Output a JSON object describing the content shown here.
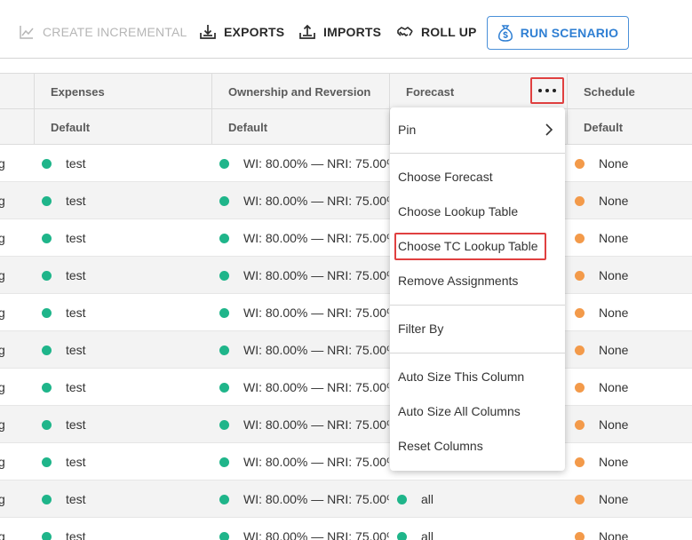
{
  "toolbar": {
    "create_incremental": "CREATE INCREMENTAL",
    "exports": "EXPORTS",
    "imports": "IMPORTS",
    "roll_up": "ROLL UP",
    "run_scenario": "RUN SCENARIO",
    "accent_color": "#2f7fd3"
  },
  "columns": [
    {
      "key": "col0",
      "label": "",
      "sub": ""
    },
    {
      "key": "expenses",
      "label": "Expenses",
      "sub": "Default"
    },
    {
      "key": "ownership",
      "label": "Ownership and Reversion",
      "sub": "Default"
    },
    {
      "key": "forecast",
      "label": "Forecast",
      "sub": ""
    },
    {
      "key": "schedule",
      "label": "Schedule",
      "sub": "Default"
    }
  ],
  "rows": [
    {
      "c0": "g",
      "expenses": "test",
      "ownership": "WI: 80.00% — NRI: 75.00%",
      "forecast": "",
      "schedule": "None"
    },
    {
      "c0": "g",
      "expenses": "test",
      "ownership": "WI: 80.00% — NRI: 75.00%",
      "forecast": "",
      "schedule": "None"
    },
    {
      "c0": "g",
      "expenses": "test",
      "ownership": "WI: 80.00% — NRI: 75.00%",
      "forecast": "",
      "schedule": "None"
    },
    {
      "c0": "g",
      "expenses": "test",
      "ownership": "WI: 80.00% — NRI: 75.00%",
      "forecast": "",
      "schedule": "None"
    },
    {
      "c0": "g",
      "expenses": "test",
      "ownership": "WI: 80.00% — NRI: 75.00%",
      "forecast": "",
      "schedule": "None"
    },
    {
      "c0": "g",
      "expenses": "test",
      "ownership": "WI: 80.00% — NRI: 75.00%",
      "forecast": "",
      "schedule": "None"
    },
    {
      "c0": "g",
      "expenses": "test",
      "ownership": "WI: 80.00% — NRI: 75.00%",
      "forecast": "",
      "schedule": "None"
    },
    {
      "c0": "g",
      "expenses": "test",
      "ownership": "WI: 80.00% — NRI: 75.00%",
      "forecast": "",
      "schedule": "None"
    },
    {
      "c0": "g",
      "expenses": "test",
      "ownership": "WI: 80.00% — NRI: 75.00%",
      "forecast": "",
      "schedule": "None"
    },
    {
      "c0": "g",
      "expenses": "test",
      "ownership": "WI: 80.00% — NRI: 75.00%",
      "forecast": "all",
      "schedule": "None"
    },
    {
      "c0": "g",
      "expenses": "test",
      "ownership": "WI: 80.00% — NRI: 75.00%",
      "forecast": "all",
      "schedule": "None"
    }
  ],
  "status_colors": {
    "assigned": "#1fb58a",
    "none": "#f39a4a"
  },
  "menu": {
    "pin": "Pin",
    "choose_forecast": "Choose Forecast",
    "choose_lookup_table": "Choose Lookup Table",
    "choose_tc_lookup_table": "Choose TC Lookup Table",
    "remove_assignments": "Remove Assignments",
    "filter_by": "Filter By",
    "auto_size_this": "Auto Size This Column",
    "auto_size_all": "Auto Size All Columns",
    "reset_columns": "Reset Columns"
  },
  "icons": {
    "create_incremental": "chart-icon",
    "exports": "export-icon",
    "imports": "import-icon",
    "roll_up": "rollup-icon",
    "run_scenario": "money-bag-icon",
    "column_menu": "more-horizontal-icon",
    "pin_submenu": "chevron-right-icon"
  }
}
